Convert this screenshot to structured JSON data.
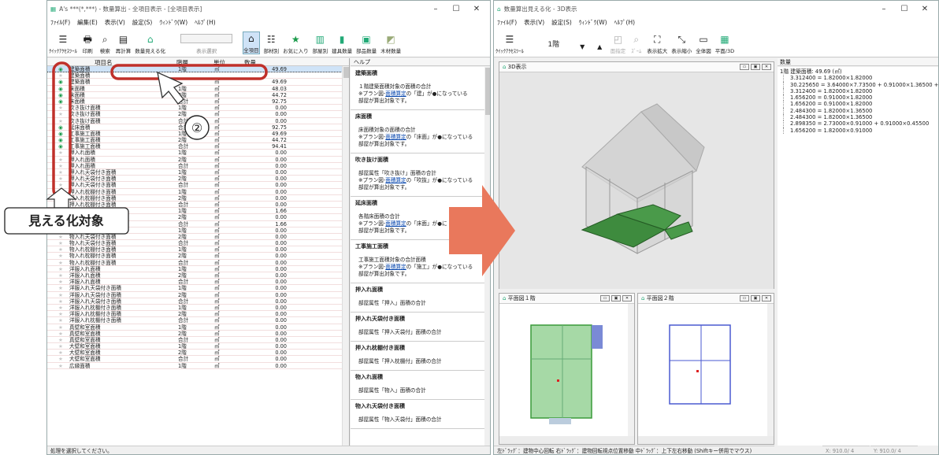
{
  "left_window": {
    "title": "A's ***(*,***) - 数量算出 - 全項目表示 - [全項目表示]",
    "menus": [
      "ﾌｧｲﾙ(F)",
      "編集(E)",
      "表示(V)",
      "設定(S)",
      "ｳｨﾝﾄﾞｳ(W)",
      "ﾍﾙﾌﾟ(H)"
    ],
    "toolbar": {
      "quick": "ｸｲｯｸｱｸｾｽﾂｰﾙ",
      "print": "印刷",
      "search": "検索",
      "recalc": "再計算",
      "visualize": "数量見える化",
      "display_select": "表示選択",
      "all": "全項目",
      "by_member": "部材別",
      "favorite": "お気に入り",
      "by_room": "部屋別",
      "fittings": "建具数量",
      "parts": "部品数量",
      "wood": "木材数量"
    },
    "headers": [
      "項目名",
      "階層",
      "単位",
      "数量"
    ],
    "help_label": "ヘルプ",
    "status": "処理を選択してください。"
  },
  "rows": [
    [
      "建築面積",
      "1階",
      "㎡",
      "49.69"
    ],
    [
      "建築面積",
      "",
      "",
      ""
    ],
    [
      "建築面積",
      "",
      "㎡",
      "49.69"
    ],
    [
      "床面積",
      "1階",
      "㎡",
      "48.03"
    ],
    [
      "床面積",
      "2階",
      "㎡",
      "44.72"
    ],
    [
      "床面積",
      "合計",
      "㎡",
      "92.75"
    ],
    [
      "吹き抜け面積",
      "1階",
      "㎡",
      "0.00"
    ],
    [
      "吹き抜け面積",
      "2階",
      "㎡",
      "0.00"
    ],
    [
      "吹き抜け面積",
      "合計",
      "㎡",
      "0.00"
    ],
    [
      "延床面積",
      "合計",
      "㎡",
      "92.75"
    ],
    [
      "工事施工面積",
      "1階",
      "㎡",
      "49.69"
    ],
    [
      "工事施工面積",
      "2階",
      "㎡",
      "44.72"
    ],
    [
      "工事施工面積",
      "合計",
      "㎡",
      "94.41"
    ],
    [
      "押入れ面積",
      "1階",
      "㎡",
      "0.00"
    ],
    [
      "押入れ面積",
      "2階",
      "㎡",
      "0.00"
    ],
    [
      "押入れ面積",
      "合計",
      "㎡",
      "0.00"
    ],
    [
      "押入れ天袋付き面積",
      "1階",
      "㎡",
      "0.00"
    ],
    [
      "押入れ天袋付き面積",
      "2階",
      "㎡",
      "0.00"
    ],
    [
      "押入れ天袋付き面積",
      "合計",
      "㎡",
      "0.00"
    ],
    [
      "押入れ枕棚付き面積",
      "1階",
      "㎡",
      "0.00"
    ],
    [
      "押入れ枕棚付き面積",
      "2階",
      "㎡",
      "0.00"
    ],
    [
      "押入れ枕棚付き面積",
      "合計",
      "㎡",
      "0.00"
    ],
    [
      "物入れ面積",
      "1階",
      "㎡",
      "1.66"
    ],
    [
      "物入れ面積",
      "2階",
      "㎡",
      "0.00"
    ],
    [
      "物入れ面積",
      "合計",
      "㎡",
      "1.66"
    ],
    [
      "物入れ天袋付き面積",
      "1階",
      "㎡",
      "0.00"
    ],
    [
      "物入れ天袋付き面積",
      "2階",
      "㎡",
      "0.00"
    ],
    [
      "物入れ天袋付き面積",
      "合計",
      "㎡",
      "0.00"
    ],
    [
      "物入れ枕棚付き面積",
      "1階",
      "㎡",
      "0.00"
    ],
    [
      "物入れ枕棚付き面積",
      "2階",
      "㎡",
      "0.00"
    ],
    [
      "物入れ枕棚付き面積",
      "合計",
      "㎡",
      "0.00"
    ],
    [
      "洋服入れ面積",
      "1階",
      "㎡",
      "0.00"
    ],
    [
      "洋服入れ面積",
      "2階",
      "㎡",
      "0.00"
    ],
    [
      "洋服入れ面積",
      "合計",
      "㎡",
      "0.00"
    ],
    [
      "洋服入れ天袋付き面積",
      "1階",
      "㎡",
      "0.00"
    ],
    [
      "洋服入れ天袋付き面積",
      "2階",
      "㎡",
      "0.00"
    ],
    [
      "洋服入れ天袋付き面積",
      "合計",
      "㎡",
      "0.00"
    ],
    [
      "洋服入れ枕棚付き面積",
      "1階",
      "㎡",
      "0.00"
    ],
    [
      "洋服入れ枕棚付き面積",
      "2階",
      "㎡",
      "0.00"
    ],
    [
      "洋服入れ枕棚付き面積",
      "合計",
      "㎡",
      "0.00"
    ],
    [
      "真壁和室面積",
      "1階",
      "㎡",
      "0.00"
    ],
    [
      "真壁和室面積",
      "2階",
      "㎡",
      "0.00"
    ],
    [
      "真壁和室面積",
      "合計",
      "㎡",
      "0.00"
    ],
    [
      "大壁和室面積",
      "1階",
      "㎡",
      "0.00"
    ],
    [
      "大壁和室面積",
      "2階",
      "㎡",
      "0.00"
    ],
    [
      "大壁和室面積",
      "合計",
      "㎡",
      "0.00"
    ],
    [
      "広縁面積",
      "1階",
      "㎡",
      "0.00"
    ]
  ],
  "help": [
    {
      "h": "建築面積",
      "lines": [
        "１階建築面積対象の面積の合計",
        "※プラン図-",
        "面積算定",
        "の「建」が●になっている",
        "部屋が算出対象です。"
      ]
    },
    {
      "h": "床面積",
      "lines": [
        "床面積対象の面積の合計",
        "※プラン図-",
        "面積算定",
        "の「床面」が●になっている",
        "部屋が算出対象です。"
      ]
    },
    {
      "h": "吹き抜け面積",
      "lines": [
        "部屋属性「吹き抜け」面積の合計",
        "※プラン図-",
        "面積算定",
        "の「吹抜」が●になっている",
        "部屋が算出対象です。"
      ]
    },
    {
      "h": "延床面積",
      "lines": [
        "各階床面積の合計",
        "※プラン図-",
        "面積算定",
        "の「床面」が●に",
        "部屋が算出対象です。"
      ]
    },
    {
      "h": "工事施工面積",
      "lines": [
        "工事施工面積対象の合計面積",
        "※プラン図-",
        "面積算定",
        "の「施工」が●になっている",
        "部屋が算出対象です。"
      ]
    },
    {
      "h": "押入れ面積",
      "lines": [
        "部屋属性「押入」面積の合計"
      ]
    },
    {
      "h": "押入れ天袋付き面積",
      "lines": [
        "部屋属性「押入天袋付」面積の合計"
      ]
    },
    {
      "h": "押入れ枕棚付き面積",
      "lines": [
        "部屋属性「押入枕棚付」面積の合計"
      ]
    },
    {
      "h": "物入れ面積",
      "lines": [
        "部屋属性「物入」面積の合計"
      ]
    },
    {
      "h": "物入れ天袋付き面積",
      "lines": [
        "部屋属性「物入天袋付」面積の合計"
      ]
    }
  ],
  "annotations": {
    "badge": "②",
    "label": "見える化対象"
  },
  "right_window": {
    "title": "数量算出見える化 - 3D表示",
    "menus": [
      "ﾌｧｲﾙ(F)",
      "表示(V)",
      "設定(S)",
      "ｳｨﾝﾄﾞｳ(W)",
      "ﾍﾙﾌﾟ(H)"
    ],
    "toolbar": {
      "quick": "ｸｲｯｸｱｸｾｽﾂｰﾙ",
      "floor": "1階",
      "center": "面指定",
      "zoom": "ｽﾞｰﾑ",
      "enlarge": "表示拡大",
      "shrink": "表示縮小",
      "whole": "全体図",
      "plan3d": "平面/3D"
    },
    "pane3d": "3D表示",
    "plan1": "平面図１階",
    "plan2": "平面図２階",
    "qty_header": "数量",
    "tree": [
      "1階 建築面積: 49.69 (㎡)",
      "3.312400 = 1.82000×1.82000",
      "30.225650 = 3.64000×7.73500 + 0.91000×1.36500 + 1",
      "3.312400 = 1.82000×1.82000",
      "1.656200 = 0.91000×1.82000",
      "1.656200 = 0.91000×1.82000",
      "2.484300 = 1.82000×1.36500",
      "2.484300 = 1.82000×1.36500",
      "2.898350 = 2.73000×0.91000 + 0.91000×0.45500",
      "1.656200 = 1.82000×0.91000"
    ],
    "status": "左ﾄﾞﾗｯｸﾞ：建物中心回転 右ﾄﾞﾗｯｸﾞ：建物回転視点位置移動 中ﾄﾞﾗｯｸﾞ：上下左右移動 (Shiftキー併用でマウス)",
    "coord_x": "X: 910.0/ 4",
    "coord_y": "Y: 910.0/ 4"
  }
}
